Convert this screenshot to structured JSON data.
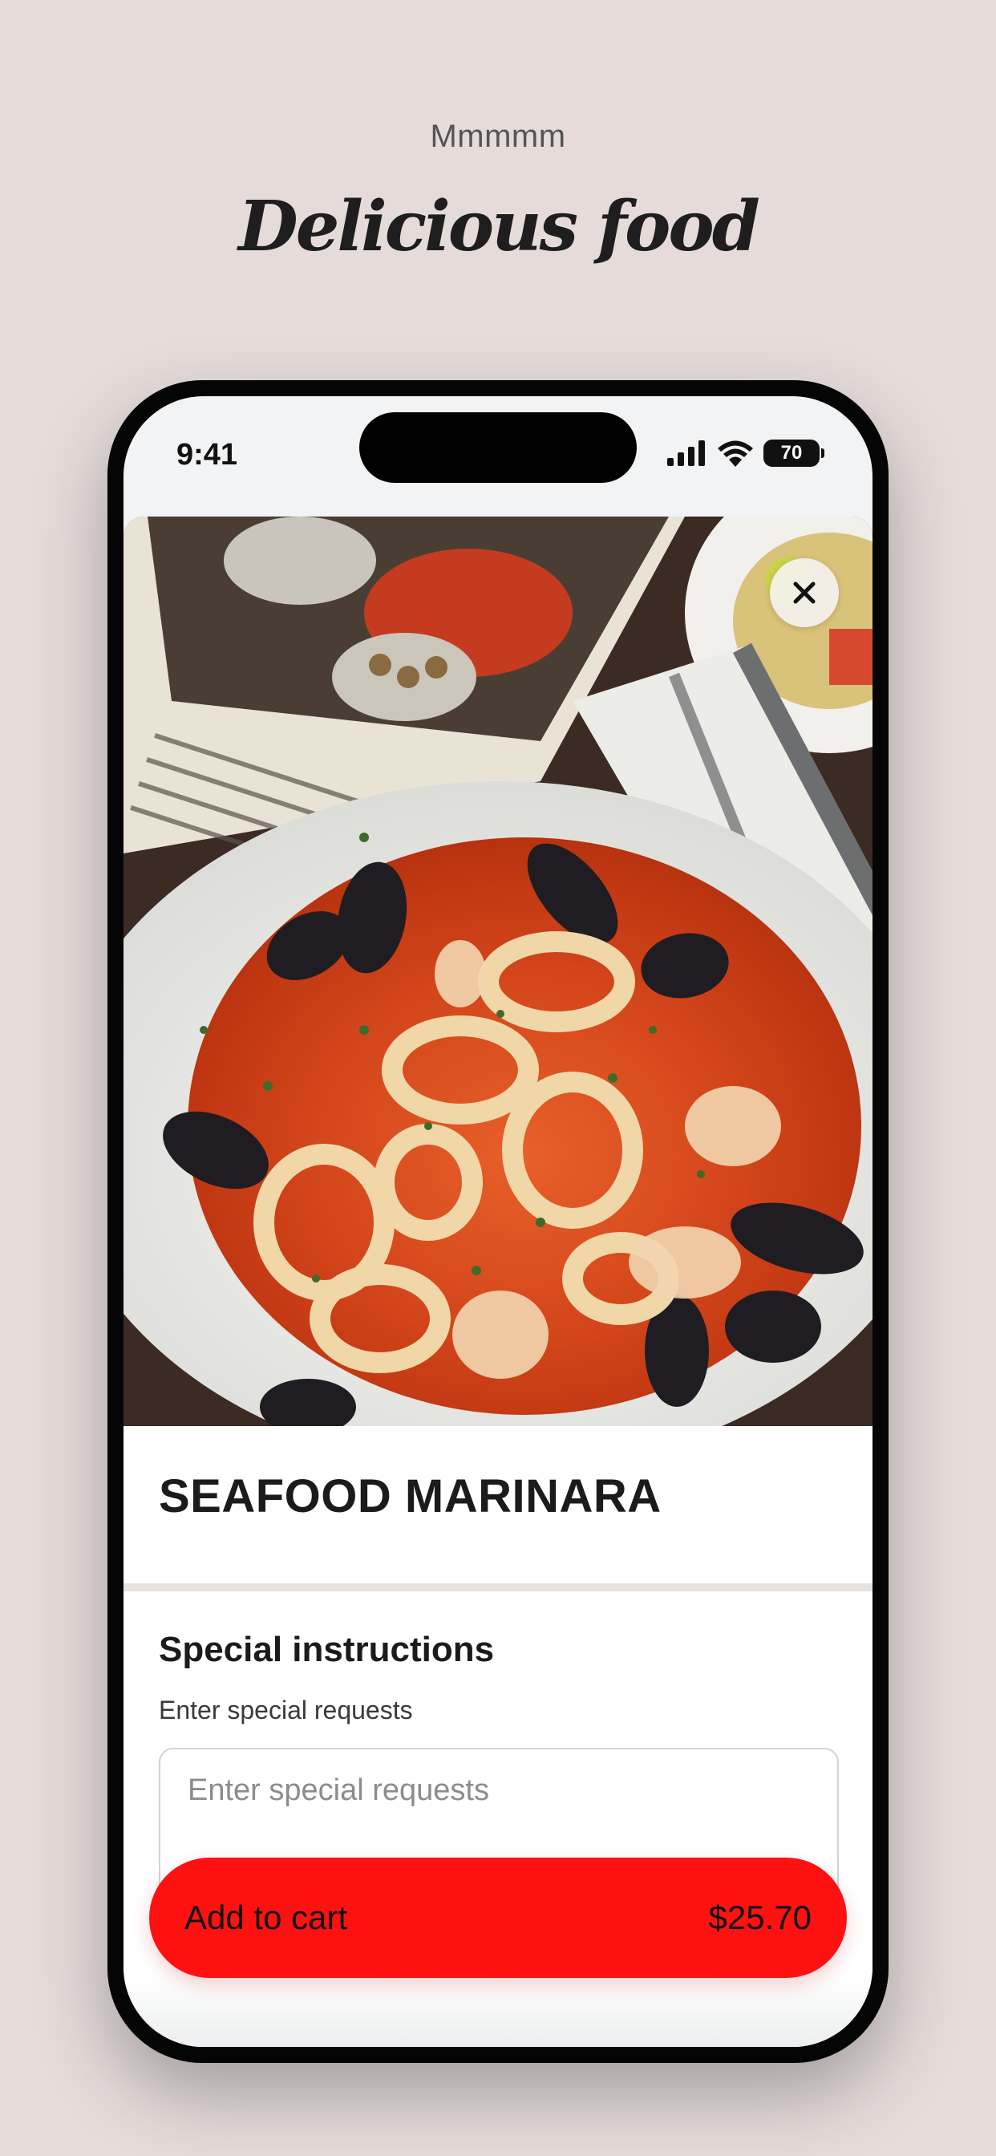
{
  "page": {
    "eyebrow": "Mmmmm",
    "headline": "Delicious food"
  },
  "status_bar": {
    "time": "9:41",
    "battery": "70"
  },
  "dish": {
    "image_icon": "seafood-marinara-photo",
    "name": "SEAFOOD MARINARA"
  },
  "special_instructions": {
    "heading": "Special instructions",
    "sublabel": "Enter special requests",
    "placeholder": "Enter special requests",
    "value": ""
  },
  "cart": {
    "label": "Add to cart",
    "price": "$25.70"
  },
  "colors": {
    "background": "#e5dcda",
    "accent": "#ff1111",
    "text": "#1b1b1b"
  }
}
